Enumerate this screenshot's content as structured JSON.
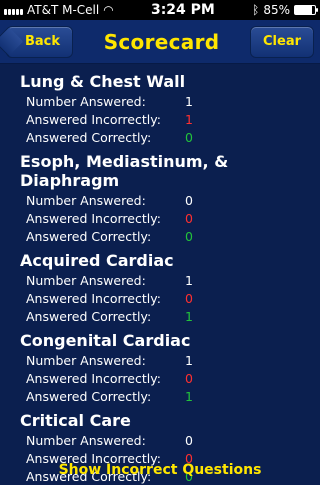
{
  "status": {
    "carrier": "AT&T M-Cell",
    "time": "3:24 PM",
    "battery": "85%"
  },
  "nav": {
    "title": "Scorecard",
    "back_label": "Back",
    "clear_label": "Clear"
  },
  "labels": {
    "answered": "Number Answered:",
    "incorrect": "Answered Incorrectly:",
    "correct": "Answered Correctly:"
  },
  "sections": [
    {
      "title": "Lung & Chest Wall",
      "answered": "1",
      "incorrect": "1",
      "correct": "0"
    },
    {
      "title": "Esoph, Mediastinum, & Diaphragm",
      "answered": "0",
      "incorrect": "0",
      "correct": "0"
    },
    {
      "title": "Acquired Cardiac",
      "answered": "1",
      "incorrect": "0",
      "correct": "1"
    },
    {
      "title": "Congenital Cardiac",
      "answered": "1",
      "incorrect": "0",
      "correct": "1"
    },
    {
      "title": "Critical Care",
      "answered": "0",
      "incorrect": "0",
      "correct": "0"
    }
  ],
  "footer": {
    "link_label": "Show Incorrect Questions"
  },
  "colors": {
    "background": "#0b1f4f",
    "accent": "#ffe600",
    "incorrect": "#ff3030",
    "correct": "#22c33b"
  }
}
